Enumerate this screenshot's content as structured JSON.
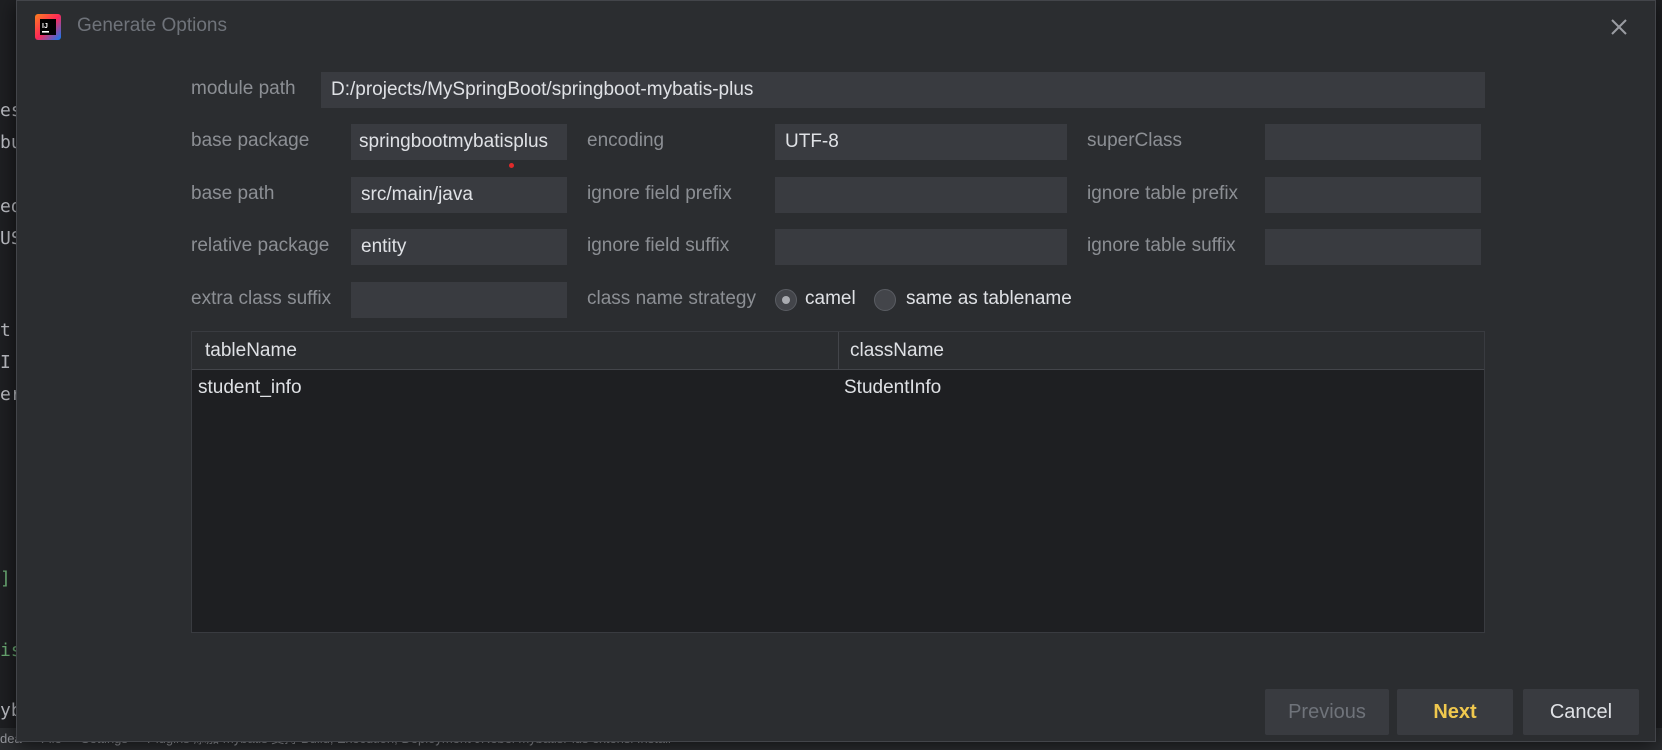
{
  "background": {
    "code_fragments": [
      "es",
      "bu",
      "ed",
      "US",
      "t",
      "I",
      "er",
      "]",
      "is",
      "yb"
    ],
    "status_text": "dea  ->  File  ->  Settings  ->  Plugins  添加 mybatis  支持       Build, Execution, Deployment         JRebel mybatisPlus extensi        Install"
  },
  "dialog": {
    "title": "Generate Options",
    "icons": {
      "app": "intellij-logo-icon",
      "close": "close-icon"
    }
  },
  "form": {
    "module_path": {
      "label": "module path",
      "value": "D:/projects/MySpringBoot/springboot-mybatis-plus"
    },
    "base_package": {
      "label": "base package",
      "value": "springbootmybatisplus"
    },
    "encoding": {
      "label": "encoding",
      "value": "UTF-8"
    },
    "super_class": {
      "label": "superClass",
      "value": ""
    },
    "base_path": {
      "label": "base path",
      "value": "src/main/java"
    },
    "ignore_field_prefix": {
      "label": "ignore field prefix",
      "value": ""
    },
    "ignore_table_prefix": {
      "label": "ignore table prefix",
      "value": ""
    },
    "relative_package": {
      "label": "relative package",
      "value": "entity"
    },
    "ignore_field_suffix": {
      "label": "ignore field suffix",
      "value": ""
    },
    "ignore_table_suffix": {
      "label": "ignore table suffix",
      "value": ""
    },
    "extra_class_suffix": {
      "label": "extra class suffix",
      "value": ""
    },
    "class_name_strategy": {
      "label": "class name strategy",
      "options": [
        "camel",
        "same as tablename"
      ],
      "selected": "camel"
    }
  },
  "table": {
    "columns": [
      "tableName",
      "className"
    ],
    "rows": [
      [
        "student_info",
        "StudentInfo"
      ]
    ]
  },
  "buttons": {
    "previous": "Previous",
    "next": "Next",
    "cancel": "Cancel"
  },
  "colors": {
    "dialog_bg": "#2b2d30",
    "field_bg": "#393b40",
    "accent_next": "#f0c84e"
  }
}
